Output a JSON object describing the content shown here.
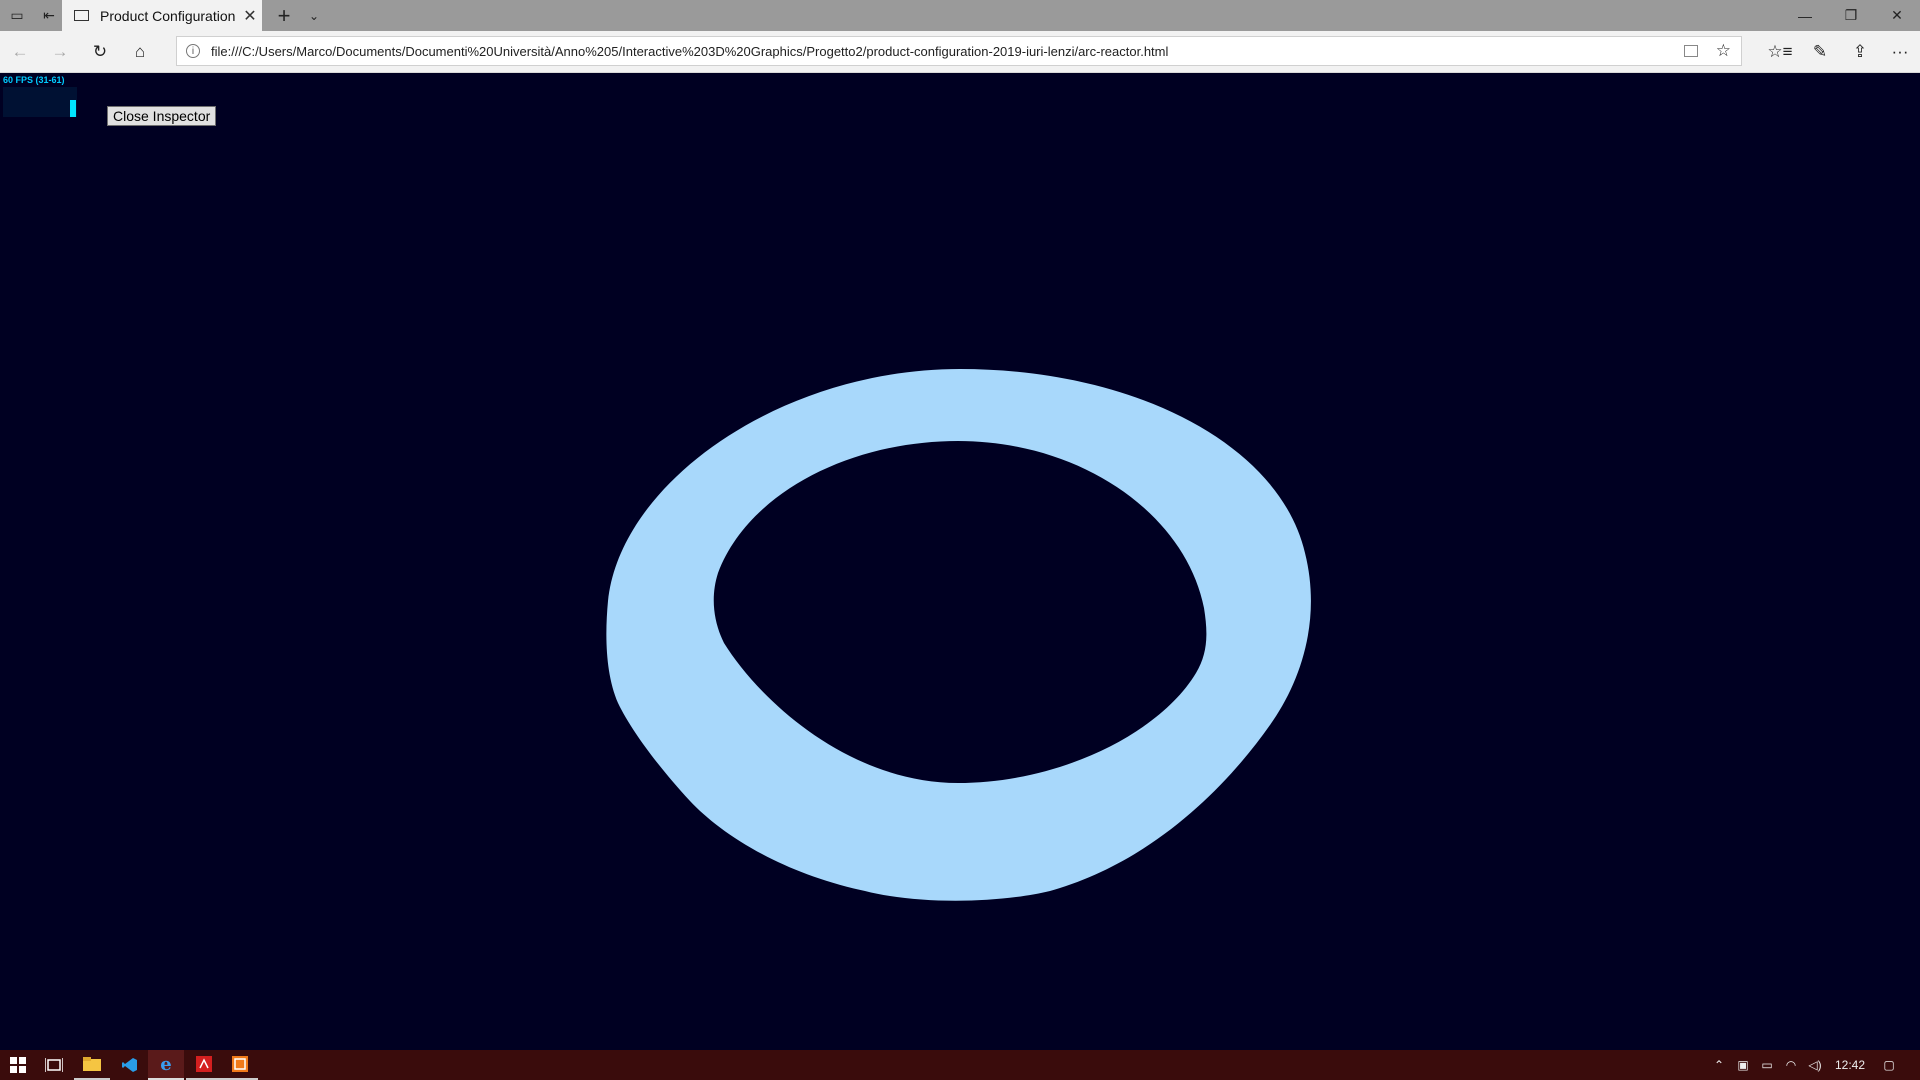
{
  "browser": {
    "tab_title": "Product Configuration",
    "tab_close_glyph": "✕",
    "new_tab_glyph": "+",
    "tab_menu_glyph": "⌄",
    "url": "file:///C:/Users/Marco/Documents/Documenti%20Università/Anno%205/Interactive%203D%20Graphics/Progetto2/product-configuration-2019-iuri-lenzi/arc-reactor.html",
    "nav": {
      "back_glyph": "←",
      "forward_glyph": "→",
      "refresh_glyph": "↻",
      "home_glyph": "⌂"
    },
    "toolbar": {
      "favorite_glyph": "☆",
      "favorites_hub_glyph": "☆≡",
      "notes_glyph": "✎",
      "share_glyph": "⇪",
      "more_glyph": "···"
    },
    "window": {
      "minimize_glyph": "—",
      "restore_glyph": "❐",
      "close_glyph": "✕"
    }
  },
  "page": {
    "background_color": "#000022",
    "torus_color": "#a8d8fb",
    "fps_label": "60 FPS (31-61)",
    "close_inspector_label": "Close Inspector"
  },
  "taskbar": {
    "start_icon": "windows-start-icon",
    "task_view_icon": "task-view-icon",
    "apps": [
      "file-explorer-icon",
      "vscode-icon",
      "edge-icon",
      "acrobat-icon",
      "app-icon"
    ],
    "clock": "12:42"
  }
}
